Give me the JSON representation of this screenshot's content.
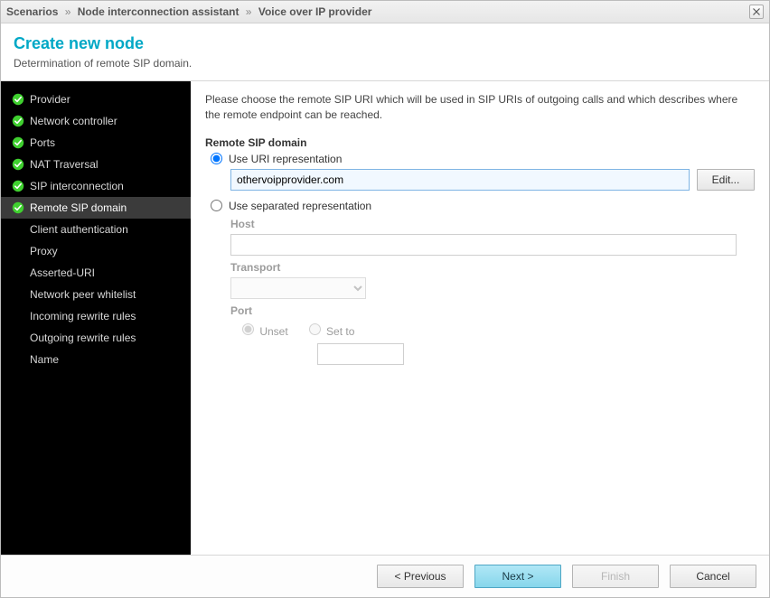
{
  "window": {
    "breadcrumbs": [
      "Scenarios",
      "Node interconnection assistant",
      "Voice over IP provider"
    ]
  },
  "header": {
    "title": "Create new node",
    "subtitle": "Determination of remote SIP domain."
  },
  "sidebar": {
    "items": [
      {
        "label": "Provider",
        "completed": true,
        "active": false
      },
      {
        "label": "Network controller",
        "completed": true,
        "active": false
      },
      {
        "label": "Ports",
        "completed": true,
        "active": false
      },
      {
        "label": "NAT Traversal",
        "completed": true,
        "active": false
      },
      {
        "label": "SIP interconnection",
        "completed": true,
        "active": false
      },
      {
        "label": "Remote SIP domain",
        "completed": true,
        "active": true
      },
      {
        "label": "Client authentication",
        "completed": false,
        "active": false
      },
      {
        "label": "Proxy",
        "completed": false,
        "active": false
      },
      {
        "label": "Asserted-URI",
        "completed": false,
        "active": false
      },
      {
        "label": "Network peer whitelist",
        "completed": false,
        "active": false
      },
      {
        "label": "Incoming rewrite rules",
        "completed": false,
        "active": false
      },
      {
        "label": "Outgoing rewrite rules",
        "completed": false,
        "active": false
      },
      {
        "label": "Name",
        "completed": false,
        "active": false
      }
    ]
  },
  "content": {
    "instructions": "Please choose the remote SIP URI which will be used in SIP URIs of outgoing calls and which describes where the remote endpoint can be reached.",
    "section_label": "Remote SIP domain",
    "uri_option": {
      "label": "Use URI representation",
      "value": "othervoipprovider.com",
      "edit_label": "Edit..."
    },
    "separated_option": {
      "label": "Use separated representation",
      "host_label": "Host",
      "host_value": "",
      "transport_label": "Transport",
      "transport_value": "",
      "port_label": "Port",
      "port_unset_label": "Unset",
      "port_setto_label": "Set to",
      "port_value": ""
    }
  },
  "footer": {
    "previous": "< Previous",
    "next": "Next >",
    "finish": "Finish",
    "cancel": "Cancel"
  }
}
